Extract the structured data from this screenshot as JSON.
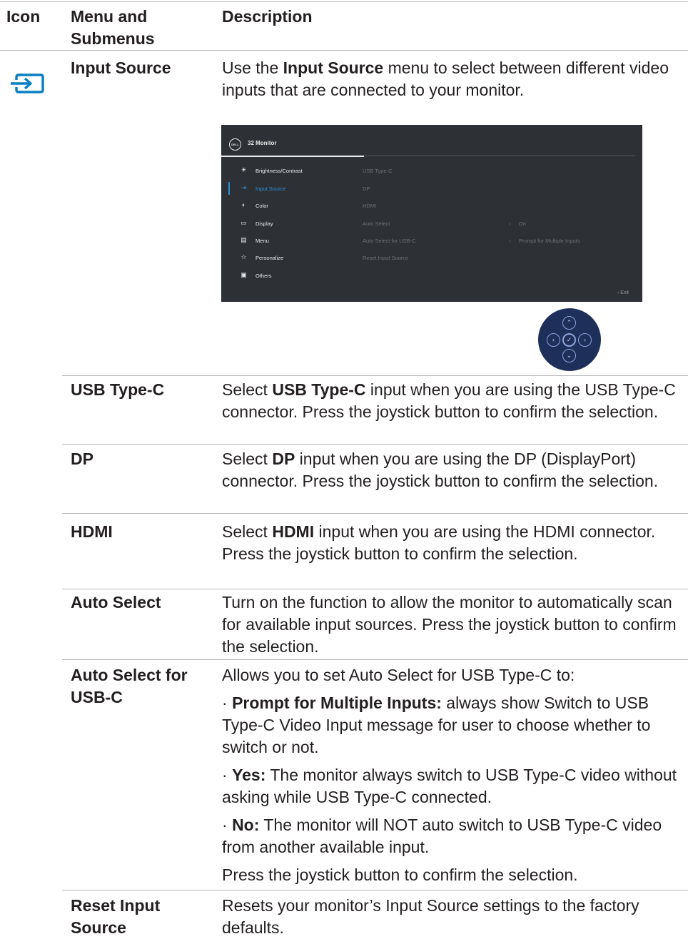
{
  "headers": {
    "icon": "Icon",
    "menu": "Menu and Submenus",
    "description": "Description"
  },
  "input_source": {
    "icon": "input-source-icon",
    "name": "Input Source",
    "desc_pre": "Use the ",
    "desc_bold": "Input Source",
    "desc_post": " menu to select between different video inputs that are connected to your monitor."
  },
  "osd": {
    "logo": "DELL",
    "title": "32 Monitor",
    "menu": [
      "Brightness/Contrast",
      "Input Source",
      "Color",
      "Display",
      "Menu",
      "Personalize",
      "Others"
    ],
    "sub": [
      "USB Type-C",
      "DP",
      "HDMI",
      "Auto Select",
      "Auto Select for USB-C",
      "Reset Input Source"
    ],
    "auto_select_value": "On",
    "auto_select_usbc_value": "Prompt for Multiple Inputs",
    "exit": "Exit",
    "accent": "#2c8fd7"
  },
  "rows": {
    "usbc": {
      "name": "USB Type-C",
      "pre": "Select ",
      "bold": "USB Type-C",
      "post": " input when you are using the USB Type-C connector. Press the joystick button to confirm the selection."
    },
    "dp": {
      "name": "DP",
      "pre": "Select ",
      "bold": "DP",
      "post": " input when you are using the DP (DisplayPort) connector. Press the joystick button to confirm the selection."
    },
    "hdmi": {
      "name": "HDMI",
      "pre": "Select ",
      "bold": "HDMI",
      "post": " input when you are using the HDMI connector. Press the joystick button to confirm the selection."
    },
    "auto": {
      "name": "Auto Select",
      "text": "Turn on the function to allow the monitor to automatically scan for available input sources. Press the joystick button to confirm the selection."
    },
    "auto_usbc": {
      "name": "Auto Select for USB-C",
      "intro": "Allows you to set Auto Select for USB Type-C to:",
      "bullets": [
        {
          "label": "Prompt for Multiple Inputs:",
          "text": " always show Switch to USB Type-C Video Input message for user to choose whether to switch or not."
        },
        {
          "label": "Yes:",
          "text": " The monitor always switch to USB Type-C video without asking while USB Type-C connected."
        },
        {
          "label": "No:",
          "text": " The monitor will NOT auto switch to USB Type-C video from another available input."
        }
      ],
      "outro": "Press the joystick button to confirm the selection."
    },
    "reset": {
      "name": "Reset Input Source",
      "pre": "Resets your monitor’s ",
      "bold": "Input Source",
      "post": " settings to the factory defaults."
    }
  }
}
